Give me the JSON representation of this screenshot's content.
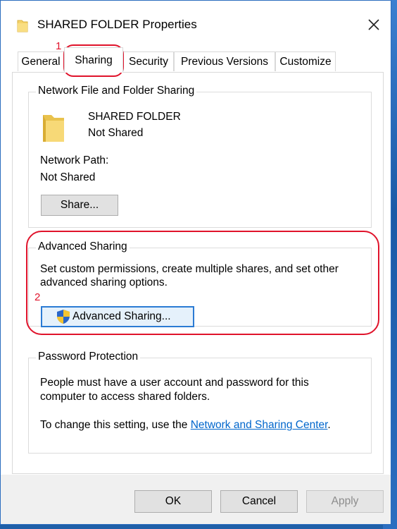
{
  "window": {
    "title": "SHARED FOLDER Properties"
  },
  "tabs": [
    {
      "label": "General"
    },
    {
      "label": "Sharing"
    },
    {
      "label": "Security"
    },
    {
      "label": "Previous Versions"
    },
    {
      "label": "Customize"
    }
  ],
  "network_sharing": {
    "group_label": "Network File and Folder Sharing",
    "folder_name": "SHARED FOLDER",
    "folder_status": "Not Shared",
    "path_label": "Network Path:",
    "path_value": "Not Shared",
    "share_button": "Share..."
  },
  "advanced_sharing": {
    "group_label": "Advanced Sharing",
    "description_line1": "Set custom permissions, create multiple shares, and set other",
    "description_line2": "advanced sharing options.",
    "button": "Advanced Sharing..."
  },
  "password_protection": {
    "group_label": "Password Protection",
    "line1": "People must have a user account and password for this",
    "line2": "computer to access shared folders.",
    "change_prefix": "To change this setting, use the",
    "link": "Network and Sharing Center",
    "change_suffix": "."
  },
  "footer": {
    "ok": "OK",
    "cancel": "Cancel",
    "apply": "Apply"
  },
  "annotations": {
    "step1": "1",
    "step2": "2"
  },
  "colors": {
    "annotation": "#e0132b",
    "link": "#0066cc",
    "folder": "#f5d36a"
  }
}
